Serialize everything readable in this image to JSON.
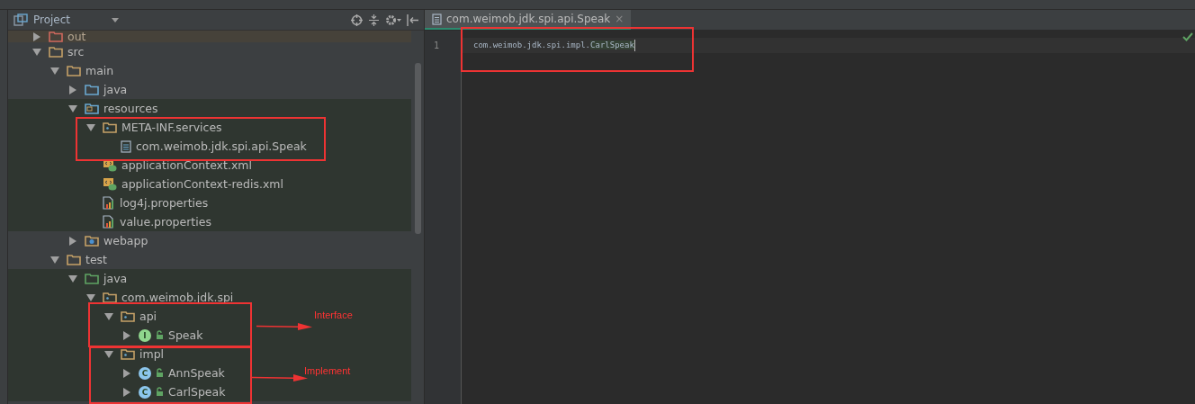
{
  "project_panel": {
    "title": "Project",
    "tree": [
      {
        "label": "out",
        "kind": "excluded-folder",
        "expanded": false,
        "excluded": true,
        "scoped": false
      },
      {
        "label": "src",
        "kind": "folder",
        "expanded": true,
        "excluded": false,
        "scoped": false,
        "children": [
          {
            "label": "main",
            "kind": "folder",
            "expanded": true,
            "excluded": false,
            "scoped": false,
            "children": [
              {
                "label": "java",
                "kind": "source-folder",
                "expanded": false,
                "excluded": false,
                "scoped": false
              },
              {
                "label": "resources",
                "kind": "resource-folder",
                "expanded": true,
                "excluded": false,
                "scoped": true,
                "children": [
                  {
                    "label": "META-INF.services",
                    "kind": "package",
                    "expanded": true,
                    "excluded": false,
                    "scoped": true,
                    "children": [
                      {
                        "label": "com.weimob.jdk.spi.api.Speak",
                        "kind": "text-file",
                        "excluded": false,
                        "scoped": true
                      }
                    ]
                  },
                  {
                    "label": "applicationContext.xml",
                    "kind": "xml-file",
                    "excluded": false,
                    "scoped": true
                  },
                  {
                    "label": "applicationContext-redis.xml",
                    "kind": "xml-file",
                    "excluded": false,
                    "scoped": true
                  },
                  {
                    "label": "log4j.properties",
                    "kind": "properties-file",
                    "excluded": false,
                    "scoped": true
                  },
                  {
                    "label": "value.properties",
                    "kind": "properties-file",
                    "excluded": false,
                    "scoped": true
                  }
                ]
              },
              {
                "label": "webapp",
                "kind": "web-folder",
                "expanded": false,
                "excluded": false,
                "scoped": false
              }
            ]
          },
          {
            "label": "test",
            "kind": "folder",
            "expanded": true,
            "excluded": false,
            "scoped": false,
            "children": [
              {
                "label": "java",
                "kind": "test-folder",
                "expanded": true,
                "excluded": false,
                "scoped": true,
                "children": [
                  {
                    "label": "com.weimob.jdk.spi",
                    "kind": "package",
                    "expanded": true,
                    "excluded": false,
                    "scoped": true,
                    "children": [
                      {
                        "label": "api",
                        "kind": "package",
                        "expanded": true,
                        "excluded": false,
                        "scoped": true,
                        "children": [
                          {
                            "label": "Speak",
                            "kind": "interface",
                            "badge": "I",
                            "expanded": false,
                            "excluded": false,
                            "scoped": true
                          }
                        ]
                      },
                      {
                        "label": "impl",
                        "kind": "package",
                        "expanded": true,
                        "excluded": false,
                        "scoped": true,
                        "children": [
                          {
                            "label": "AnnSpeak",
                            "kind": "class",
                            "badge": "C",
                            "expanded": false,
                            "excluded": false,
                            "scoped": true
                          },
                          {
                            "label": "CarlSpeak",
                            "kind": "class",
                            "badge": "C",
                            "expanded": false,
                            "excluded": false,
                            "scoped": true
                          }
                        ]
                      }
                    ]
                  }
                ]
              }
            ]
          }
        ]
      }
    ]
  },
  "editor": {
    "tab": {
      "label": "com.weimob.jdk.spi.api.Speak",
      "close": "×",
      "selected": true
    },
    "lines": [
      {
        "number": "1",
        "prefix": "com.weimob.jdk.spi.impl.",
        "highlighted": "CarlSpeak"
      }
    ]
  },
  "annotations": [
    {
      "kind": "box"
    },
    {
      "kind": "box",
      "label": "Interface"
    },
    {
      "kind": "box",
      "label": "Implement"
    },
    {
      "kind": "box"
    }
  ]
}
